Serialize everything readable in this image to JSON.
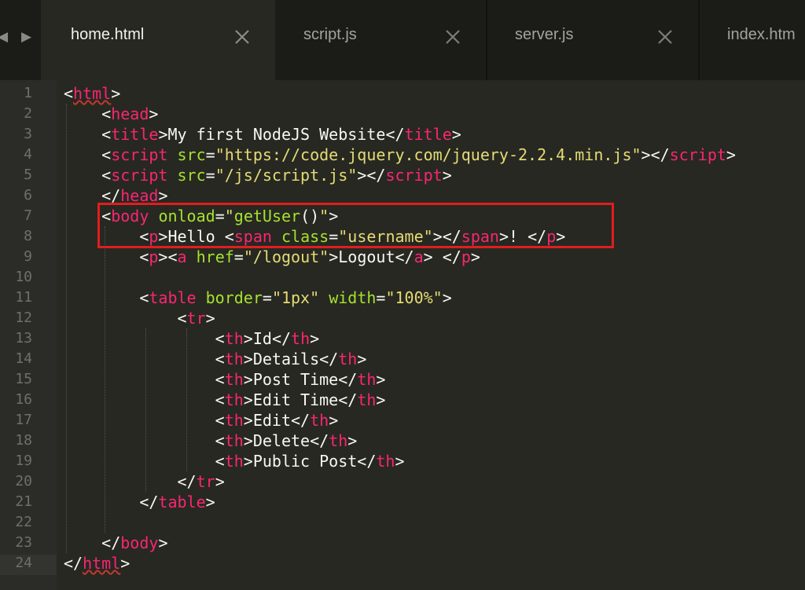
{
  "nav": {
    "back_icon": "triangle-left-icon",
    "forward_icon": "triangle-right-icon"
  },
  "tabs": [
    {
      "label": "home.html",
      "active": true,
      "close_icon": "close-icon"
    },
    {
      "label": "script.js",
      "active": false,
      "close_icon": "close-icon"
    },
    {
      "label": "server.js",
      "active": false,
      "close_icon": "close-icon"
    },
    {
      "label": "index.htm",
      "active": false
    }
  ],
  "colors": {
    "background": "#272822",
    "tag": "#f92672",
    "attribute": "#a6e22e",
    "string": "#e6db74",
    "text": "#f8f8f2",
    "highlight_box": "#e01e1e"
  },
  "editor": {
    "current_line": 24,
    "highlighted_lines": [
      7,
      8
    ],
    "lines": [
      {
        "num": "1",
        "tokens": [
          [
            "p",
            "<"
          ],
          [
            "t",
            "html"
          ],
          [
            "p",
            ">"
          ]
        ]
      },
      {
        "num": "2",
        "tokens": [
          [
            "s",
            "    "
          ],
          [
            "p",
            "<"
          ],
          [
            "t",
            "head"
          ],
          [
            "p",
            ">"
          ]
        ]
      },
      {
        "num": "3",
        "tokens": [
          [
            "s",
            "    "
          ],
          [
            "p",
            "<"
          ],
          [
            "t",
            "title"
          ],
          [
            "p",
            ">"
          ],
          [
            "x",
            "My first NodeJS Website"
          ],
          [
            "p",
            "</"
          ],
          [
            "t",
            "title"
          ],
          [
            "p",
            ">"
          ]
        ]
      },
      {
        "num": "4",
        "tokens": [
          [
            "s",
            "    "
          ],
          [
            "p",
            "<"
          ],
          [
            "t",
            "script"
          ],
          [
            "s",
            " "
          ],
          [
            "a",
            "src"
          ],
          [
            "p",
            "="
          ],
          [
            "q",
            "\"https://code.jquery.com/jquery-2.2.4.min.js\""
          ],
          [
            "p",
            "></"
          ],
          [
            "t",
            "script"
          ],
          [
            "p",
            ">"
          ]
        ]
      },
      {
        "num": "5",
        "tokens": [
          [
            "s",
            "    "
          ],
          [
            "p",
            "<"
          ],
          [
            "t",
            "script"
          ],
          [
            "s",
            " "
          ],
          [
            "a",
            "src"
          ],
          [
            "p",
            "="
          ],
          [
            "q",
            "\"/js/script.js\""
          ],
          [
            "p",
            "></"
          ],
          [
            "t",
            "script"
          ],
          [
            "p",
            ">"
          ]
        ]
      },
      {
        "num": "6",
        "tokens": [
          [
            "s",
            "    "
          ],
          [
            "p",
            "</"
          ],
          [
            "t",
            "head"
          ],
          [
            "p",
            ">"
          ]
        ]
      },
      {
        "num": "7",
        "tokens": [
          [
            "s",
            "    "
          ],
          [
            "p",
            "<"
          ],
          [
            "t",
            "body"
          ],
          [
            "s",
            " "
          ],
          [
            "a",
            "onload"
          ],
          [
            "p",
            "="
          ],
          [
            "q",
            "\""
          ],
          [
            "a",
            "getUser"
          ],
          [
            "p",
            "()"
          ],
          [
            "q",
            "\""
          ],
          [
            "p",
            ">"
          ]
        ]
      },
      {
        "num": "8",
        "tokens": [
          [
            "s",
            "        "
          ],
          [
            "p",
            "<"
          ],
          [
            "t",
            "p"
          ],
          [
            "p",
            ">"
          ],
          [
            "x",
            "Hello "
          ],
          [
            "p",
            "<"
          ],
          [
            "t",
            "span"
          ],
          [
            "s",
            " "
          ],
          [
            "a",
            "class"
          ],
          [
            "p",
            "="
          ],
          [
            "q",
            "\"username\""
          ],
          [
            "p",
            "></"
          ],
          [
            "t",
            "span"
          ],
          [
            "p",
            ">"
          ],
          [
            "x",
            "! "
          ],
          [
            "p",
            "</"
          ],
          [
            "t",
            "p"
          ],
          [
            "p",
            ">"
          ]
        ]
      },
      {
        "num": "9",
        "tokens": [
          [
            "s",
            "        "
          ],
          [
            "p",
            "<"
          ],
          [
            "t",
            "p"
          ],
          [
            "p",
            "><"
          ],
          [
            "t",
            "a"
          ],
          [
            "s",
            " "
          ],
          [
            "a",
            "href"
          ],
          [
            "p",
            "="
          ],
          [
            "q",
            "\"/logout\""
          ],
          [
            "p",
            ">"
          ],
          [
            "x",
            "Logout"
          ],
          [
            "p",
            "</"
          ],
          [
            "t",
            "a"
          ],
          [
            "p",
            ">"
          ],
          [
            "x",
            " "
          ],
          [
            "p",
            "</"
          ],
          [
            "t",
            "p"
          ],
          [
            "p",
            ">"
          ]
        ]
      },
      {
        "num": "10",
        "tokens": []
      },
      {
        "num": "11",
        "tokens": [
          [
            "s",
            "        "
          ],
          [
            "p",
            "<"
          ],
          [
            "t",
            "table"
          ],
          [
            "s",
            " "
          ],
          [
            "a",
            "border"
          ],
          [
            "p",
            "="
          ],
          [
            "q",
            "\"1px\""
          ],
          [
            "s",
            " "
          ],
          [
            "a",
            "width"
          ],
          [
            "p",
            "="
          ],
          [
            "q",
            "\"100%\""
          ],
          [
            "p",
            ">"
          ]
        ]
      },
      {
        "num": "12",
        "tokens": [
          [
            "s",
            "            "
          ],
          [
            "p",
            "<"
          ],
          [
            "t",
            "tr"
          ],
          [
            "p",
            ">"
          ]
        ]
      },
      {
        "num": "13",
        "tokens": [
          [
            "s",
            "                "
          ],
          [
            "p",
            "<"
          ],
          [
            "t",
            "th"
          ],
          [
            "p",
            ">"
          ],
          [
            "x",
            "Id"
          ],
          [
            "p",
            "</"
          ],
          [
            "t",
            "th"
          ],
          [
            "p",
            ">"
          ]
        ]
      },
      {
        "num": "14",
        "tokens": [
          [
            "s",
            "                "
          ],
          [
            "p",
            "<"
          ],
          [
            "t",
            "th"
          ],
          [
            "p",
            ">"
          ],
          [
            "x",
            "Details"
          ],
          [
            "p",
            "</"
          ],
          [
            "t",
            "th"
          ],
          [
            "p",
            ">"
          ]
        ]
      },
      {
        "num": "15",
        "tokens": [
          [
            "s",
            "                "
          ],
          [
            "p",
            "<"
          ],
          [
            "t",
            "th"
          ],
          [
            "p",
            ">"
          ],
          [
            "x",
            "Post Time"
          ],
          [
            "p",
            "</"
          ],
          [
            "t",
            "th"
          ],
          [
            "p",
            ">"
          ]
        ]
      },
      {
        "num": "16",
        "tokens": [
          [
            "s",
            "                "
          ],
          [
            "p",
            "<"
          ],
          [
            "t",
            "th"
          ],
          [
            "p",
            ">"
          ],
          [
            "x",
            "Edit Time"
          ],
          [
            "p",
            "</"
          ],
          [
            "t",
            "th"
          ],
          [
            "p",
            ">"
          ]
        ]
      },
      {
        "num": "17",
        "tokens": [
          [
            "s",
            "                "
          ],
          [
            "p",
            "<"
          ],
          [
            "t",
            "th"
          ],
          [
            "p",
            ">"
          ],
          [
            "x",
            "Edit"
          ],
          [
            "p",
            "</"
          ],
          [
            "t",
            "th"
          ],
          [
            "p",
            ">"
          ]
        ]
      },
      {
        "num": "18",
        "tokens": [
          [
            "s",
            "                "
          ],
          [
            "p",
            "<"
          ],
          [
            "t",
            "th"
          ],
          [
            "p",
            ">"
          ],
          [
            "x",
            "Delete"
          ],
          [
            "p",
            "</"
          ],
          [
            "t",
            "th"
          ],
          [
            "p",
            ">"
          ]
        ]
      },
      {
        "num": "19",
        "tokens": [
          [
            "s",
            "                "
          ],
          [
            "p",
            "<"
          ],
          [
            "t",
            "th"
          ],
          [
            "p",
            ">"
          ],
          [
            "x",
            "Public Post"
          ],
          [
            "p",
            "</"
          ],
          [
            "t",
            "th"
          ],
          [
            "p",
            ">"
          ]
        ]
      },
      {
        "num": "20",
        "tokens": [
          [
            "s",
            "            "
          ],
          [
            "p",
            "</"
          ],
          [
            "t",
            "tr"
          ],
          [
            "p",
            ">"
          ]
        ]
      },
      {
        "num": "21",
        "tokens": [
          [
            "s",
            "        "
          ],
          [
            "p",
            "</"
          ],
          [
            "t",
            "table"
          ],
          [
            "p",
            ">"
          ]
        ]
      },
      {
        "num": "22",
        "tokens": []
      },
      {
        "num": "23",
        "tokens": [
          [
            "s",
            "    "
          ],
          [
            "p",
            "</"
          ],
          [
            "t",
            "body"
          ],
          [
            "p",
            ">"
          ]
        ]
      },
      {
        "num": "24",
        "tokens": [
          [
            "p",
            "</"
          ],
          [
            "t",
            "html"
          ],
          [
            "p",
            ">"
          ]
        ]
      }
    ]
  }
}
